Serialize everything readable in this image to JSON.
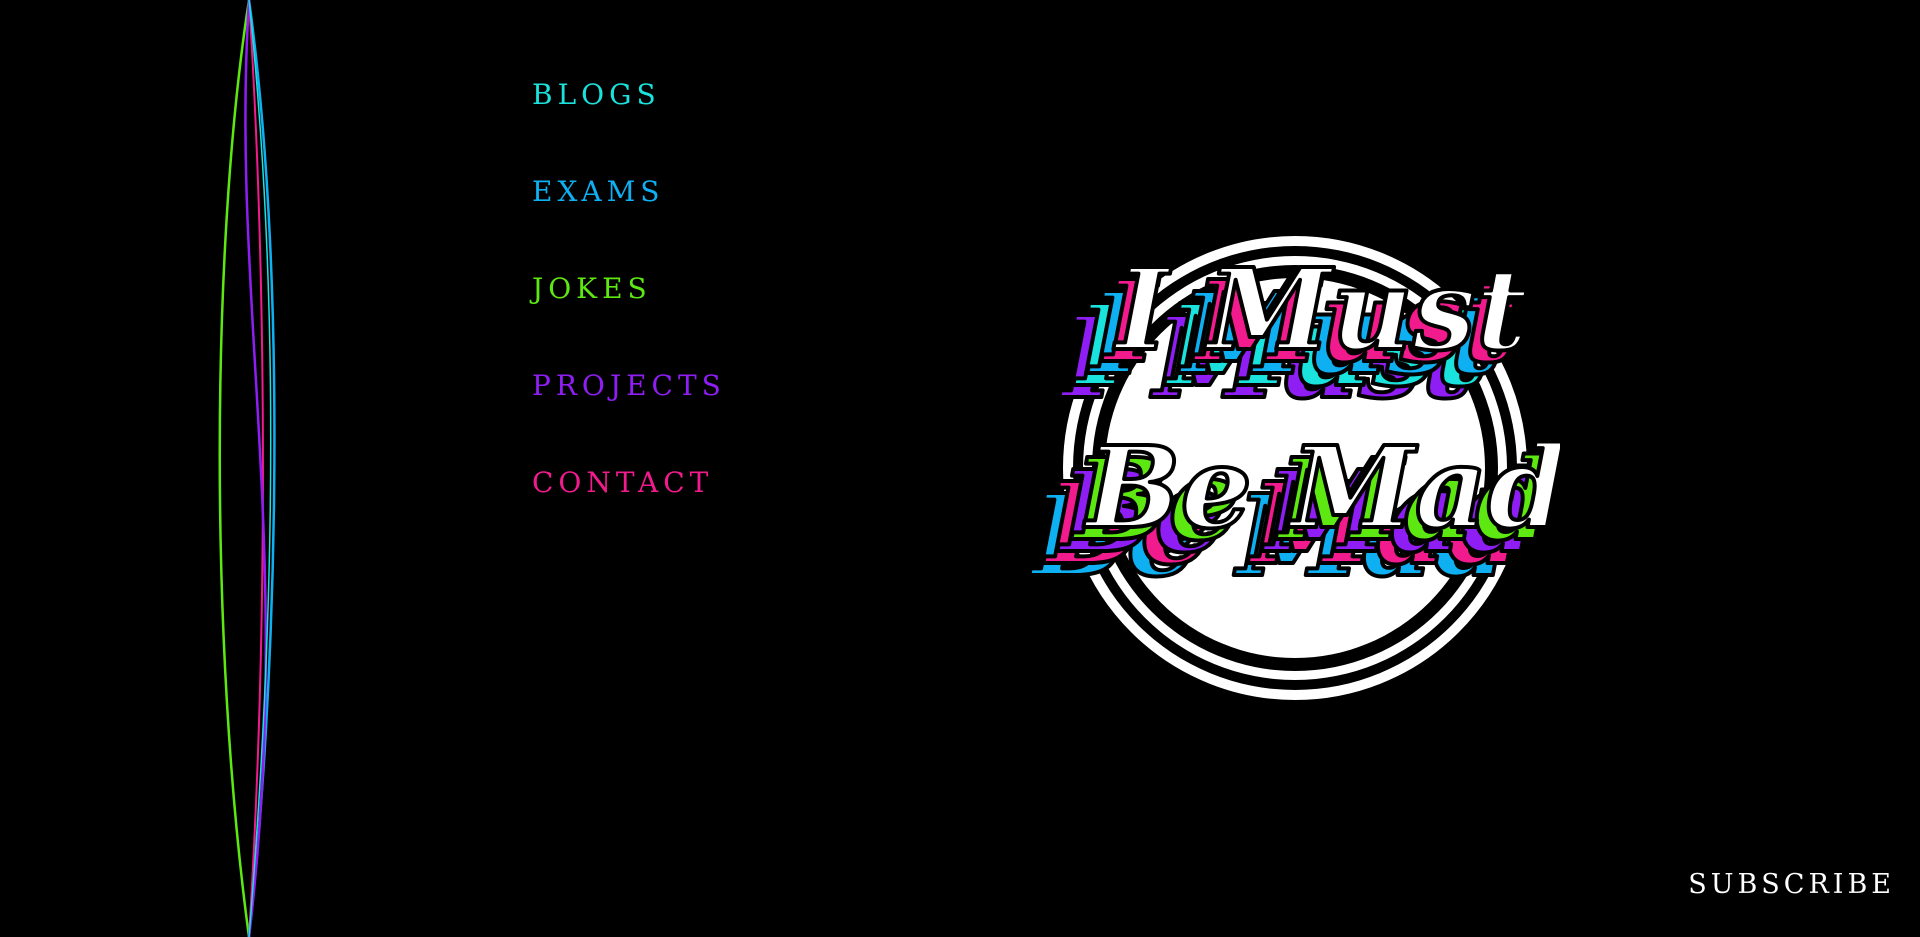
{
  "nav": {
    "items": [
      {
        "label": "BLOGS",
        "color": "#19e3dc"
      },
      {
        "label": "EXAMS",
        "color": "#0fb0f2"
      },
      {
        "label": "JOKES",
        "color": "#5ee812"
      },
      {
        "label": "PROJECTS",
        "color": "#8e1ef3"
      },
      {
        "label": "CONTACT",
        "color": "#f21b8e"
      }
    ]
  },
  "logo": {
    "line1": "I Must",
    "line2": "Be Mad"
  },
  "footer": {
    "subscribe_label": "SUBSCRIBE"
  },
  "colors": {
    "background": "#000000",
    "cyan": "#19e3dc",
    "blue": "#0fb0f2",
    "green": "#5ee812",
    "purple": "#8e1ef3",
    "pink": "#f21b8e"
  }
}
